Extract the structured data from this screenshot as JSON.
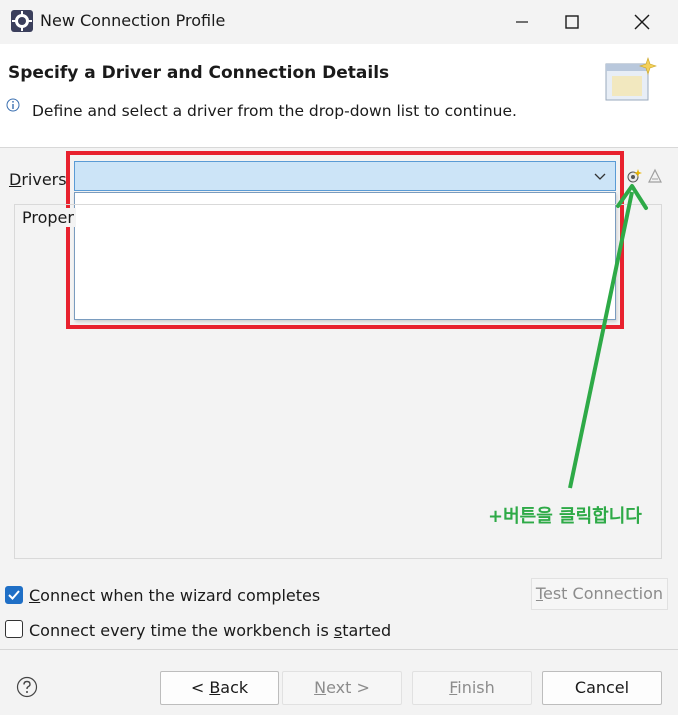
{
  "window": {
    "title": "New Connection Profile",
    "app_icon": "eclipse-gear-icon"
  },
  "header": {
    "title": "Specify a Driver and Connection Details",
    "description": "Define and select a driver from the drop-down list to continue.",
    "info_icon": "info-icon",
    "graphic": "wizard-banner-graphic"
  },
  "drivers": {
    "label_mnemonic": "D",
    "label_rest": "rivers",
    "selected_value": "",
    "new_driver_icon": "new-driver-definition-icon",
    "edit_driver_icon": "edit-driver-definition-icon"
  },
  "properties": {
    "group_label": "Proper"
  },
  "annotation": {
    "text": "+버튼을 클릭합니다",
    "color": "#2eaa47",
    "highlight_color": "#e8212e"
  },
  "options": {
    "connect_on_complete": {
      "checked": true,
      "label_mnemonic": "C",
      "label_rest": "onnect when the wizard completes"
    },
    "connect_on_start": {
      "checked": false,
      "label_before": "Connect every time the workbench is ",
      "label_mnemonic": "s",
      "label_after": "tarted"
    },
    "test_connection": {
      "label_mnemonic": "T",
      "label_rest": "est Connection"
    }
  },
  "footer": {
    "help_icon": "help-icon",
    "back": {
      "prefix": "< ",
      "mnemonic": "B",
      "rest": "ack"
    },
    "next": {
      "mnemonic": "N",
      "rest": "ext >"
    },
    "finish": {
      "mnemonic": "F",
      "rest": "inish"
    },
    "cancel": "Cancel"
  },
  "colors": {
    "accent": "#1f6fc6",
    "combo_selected": "#cce4f7"
  }
}
